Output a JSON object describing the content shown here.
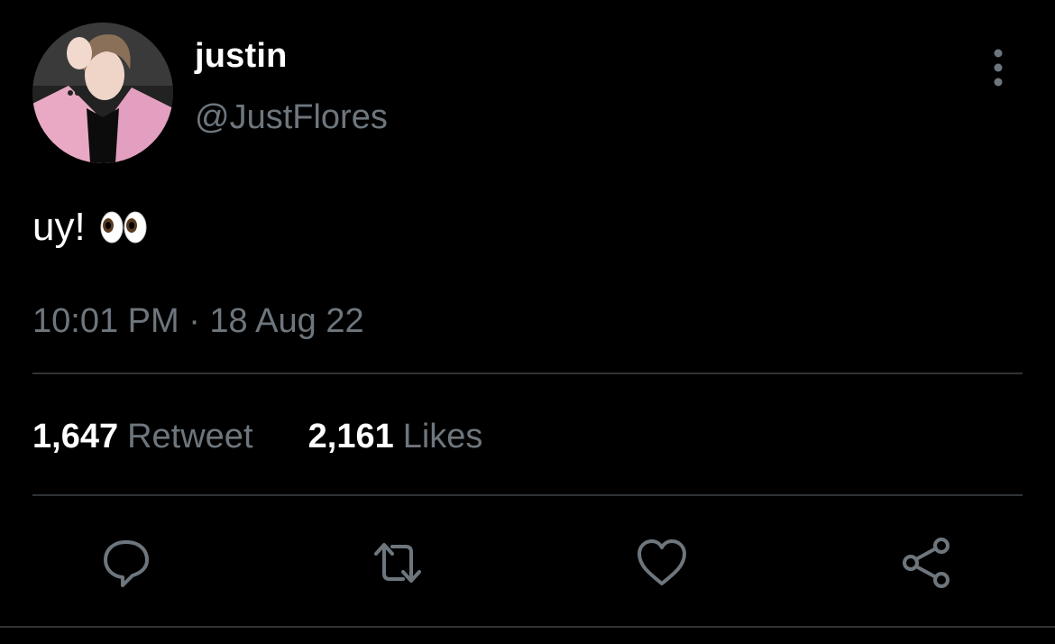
{
  "author": {
    "display_name": "justin",
    "handle": "@JustFlores",
    "avatar_icon": "profile-photo"
  },
  "tweet": {
    "text": "uy!",
    "emoji": "eyes-emoji",
    "timestamp": "10:01 PM · 18 Aug 22"
  },
  "stats": {
    "retweets_count": "1,647",
    "retweets_label": "Retweet",
    "likes_count": "2,161",
    "likes_label": "Likes"
  },
  "actions": [
    {
      "name": "reply",
      "icon": "speech-bubble-icon"
    },
    {
      "name": "retweet",
      "icon": "retweet-arrows-icon"
    },
    {
      "name": "like",
      "icon": "heart-icon"
    },
    {
      "name": "share",
      "icon": "share-nodes-icon"
    }
  ],
  "menu": {
    "icon": "vertical-ellipsis-icon"
  },
  "colors": {
    "background": "#000000",
    "primary_text": "#ffffff",
    "secondary_text": "#6e767d",
    "divider": "#2f3336",
    "icon": "#6e767d"
  }
}
